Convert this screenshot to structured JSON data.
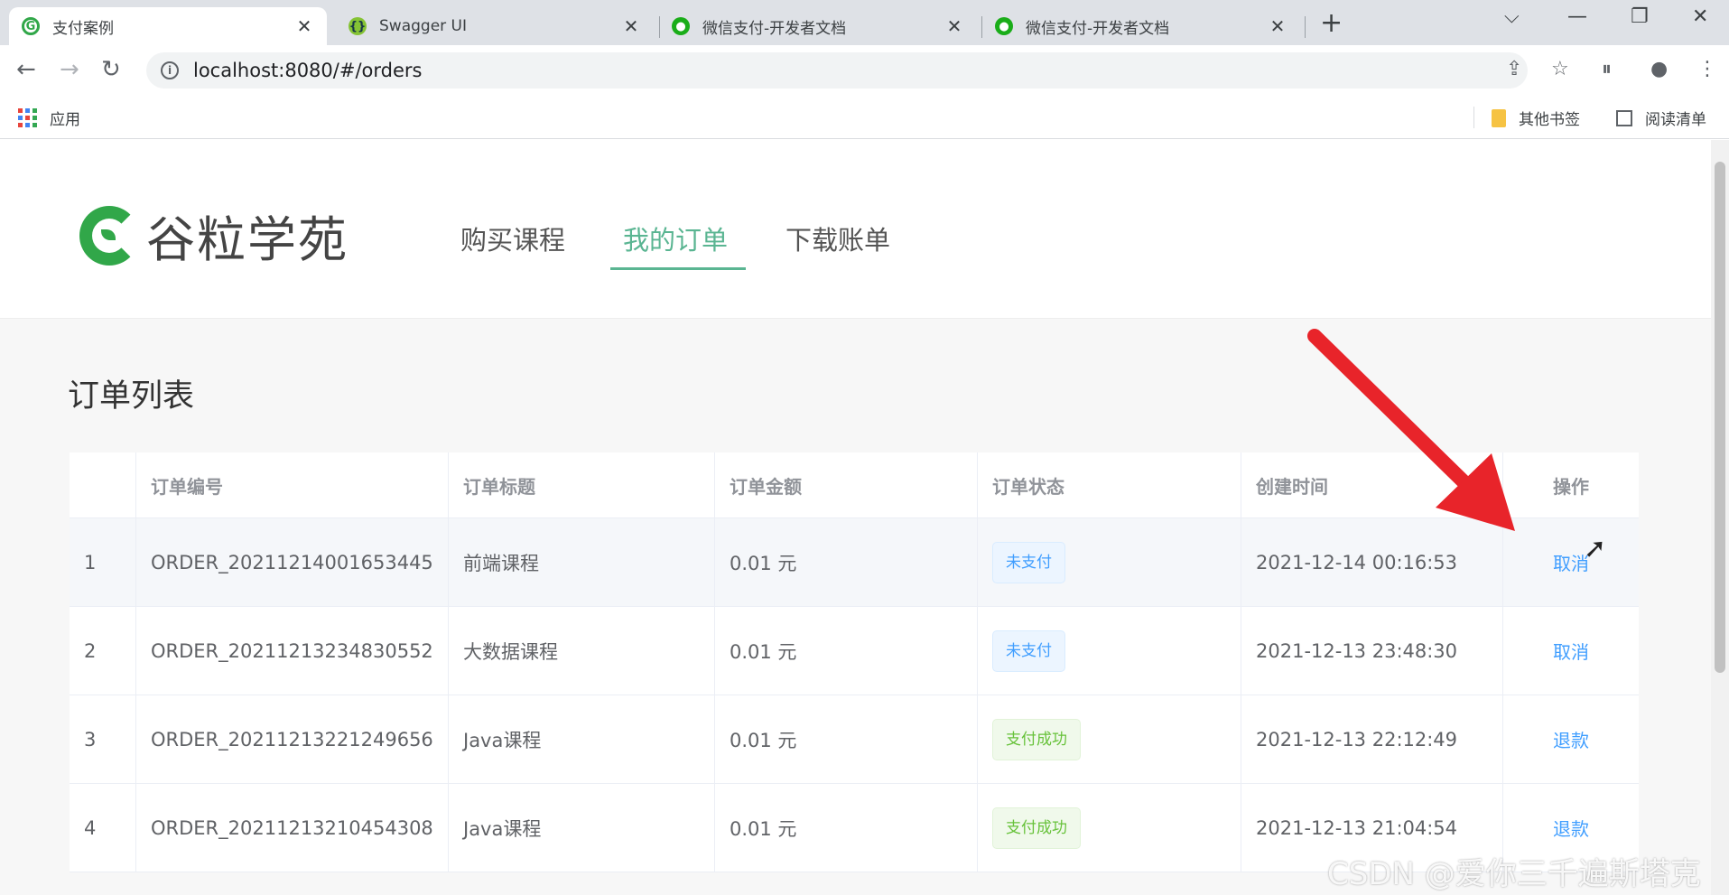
{
  "browser": {
    "tabs": [
      {
        "title": "支付案例",
        "icon": "guli-favicon-icon",
        "active": true
      },
      {
        "title": "Swagger UI",
        "icon": "swagger-favicon-icon",
        "active": false
      },
      {
        "title": "微信支付-开发者文档",
        "icon": "wechat-favicon-icon",
        "active": false
      },
      {
        "title": "微信支付-开发者文档",
        "icon": "wechat-favicon-icon",
        "active": false
      }
    ],
    "url": "localhost:8080/#/orders",
    "bookmarks": {
      "apps": "应用",
      "other": "其他书签",
      "reading_list": "阅读清单"
    }
  },
  "site": {
    "logo_text": "谷粒学苑",
    "nav": [
      {
        "label": "购买课程",
        "active": false
      },
      {
        "label": "我的订单",
        "active": true
      },
      {
        "label": "下载账单",
        "active": false
      }
    ]
  },
  "orders": {
    "title": "订单列表",
    "columns": [
      "",
      "订单编号",
      "订单标题",
      "订单金额",
      "订单状态",
      "创建时间",
      "操作"
    ],
    "rows": [
      {
        "index": "1",
        "order_no": "ORDER_20211214001653445",
        "title": "前端课程",
        "amount": "0.01 元",
        "status": "未支付",
        "status_type": "info",
        "created": "2021-12-14 00:16:53",
        "action": "取消"
      },
      {
        "index": "2",
        "order_no": "ORDER_20211213234830552",
        "title": "大数据课程",
        "amount": "0.01 元",
        "status": "未支付",
        "status_type": "info",
        "created": "2021-12-13 23:48:30",
        "action": "取消"
      },
      {
        "index": "3",
        "order_no": "ORDER_20211213221249656",
        "title": "Java课程",
        "amount": "0.01 元",
        "status": "支付成功",
        "status_type": "success",
        "created": "2021-12-13 22:12:49",
        "action": "退款"
      },
      {
        "index": "4",
        "order_no": "ORDER_20211213210454308",
        "title": "Java课程",
        "amount": "0.01 元",
        "status": "支付成功",
        "status_type": "success",
        "created": "2021-12-13 21:04:54",
        "action": "退款"
      }
    ]
  },
  "watermark": "CSDN @爱你三千遍斯塔克",
  "colors": {
    "accent": "#5ab592",
    "link": "#409eff",
    "arrow": "#e8242a"
  }
}
